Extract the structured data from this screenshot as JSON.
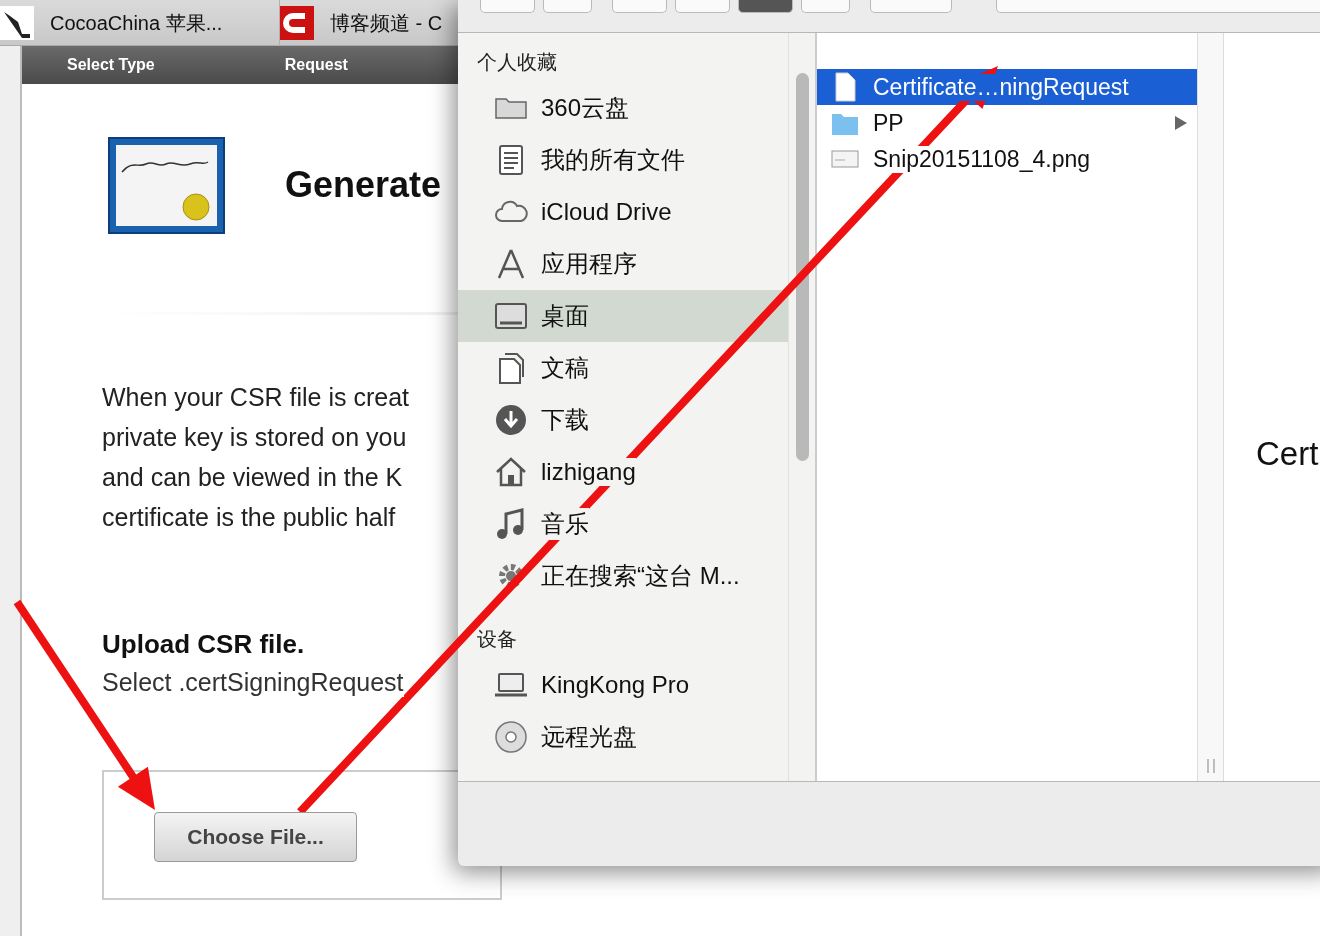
{
  "browser_tabs": [
    {
      "title": "CocoaChina 苹果...",
      "kind": "picture"
    },
    {
      "title": "博客频道 - C",
      "kind": "letter"
    }
  ],
  "steps": [
    "Select Type",
    "Request"
  ],
  "page": {
    "heading": "Generate",
    "paragraph_lines": [
      "When your CSR file is creat",
      "private key is stored on you",
      "and can be viewed in the K",
      "certificate is the public half"
    ],
    "upload_title": "Upload CSR file.",
    "upload_hint": "Select .certSigningRequest",
    "choose_button": "Choose File..."
  },
  "dialog": {
    "sidebar": [
      {
        "title": "个人收藏",
        "items": [
          {
            "label": "360云盘",
            "kind": "folder",
            "selected": false
          },
          {
            "label": "我的所有文件",
            "kind": "files",
            "selected": false
          },
          {
            "label": "iCloud Drive",
            "kind": "cloud",
            "selected": false
          },
          {
            "label": "应用程序",
            "kind": "apps",
            "selected": false
          },
          {
            "label": "桌面",
            "kind": "desktop",
            "selected": true
          },
          {
            "label": "文稿",
            "kind": "documents",
            "selected": false
          },
          {
            "label": "下载",
            "kind": "download",
            "selected": false
          },
          {
            "label": "lizhigang",
            "kind": "home",
            "selected": false
          },
          {
            "label": "音乐",
            "kind": "music",
            "selected": false
          },
          {
            "label": "正在搜索“这台 M...",
            "kind": "gear",
            "selected": false
          }
        ]
      },
      {
        "title": "设备",
        "items": [
          {
            "label": "KingKong Pro",
            "kind": "laptop",
            "selected": false
          },
          {
            "label": "远程光盘",
            "kind": "disc",
            "selected": false
          }
        ]
      }
    ],
    "files": [
      {
        "name": "Certificate…ningRequest",
        "kind": "document",
        "selected": true,
        "has_children": false
      },
      {
        "name": "PP",
        "kind": "folder",
        "selected": false,
        "has_children": true
      },
      {
        "name": "Snip20151108_4.png",
        "kind": "image",
        "selected": false,
        "has_children": false
      }
    ],
    "preview_text": "Cert"
  }
}
